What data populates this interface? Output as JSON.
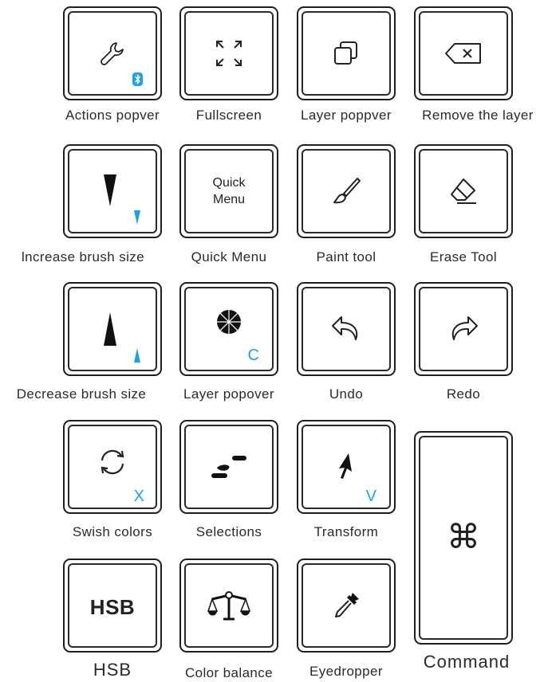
{
  "accent_color": "#1aa3e8",
  "key_border_color": "#1e1e1e",
  "keys": [
    {
      "label": "Actions popver",
      "icon": "wrench-icon",
      "badge": "bluetooth-icon"
    },
    {
      "label": "Fullscreen",
      "icon": "expand-arrows-icon"
    },
    {
      "label": "Layer poppver",
      "icon": "layers-icon"
    },
    {
      "label": "Remove the layer",
      "icon": "backspace-icon"
    },
    {
      "label": "lncrease brush size",
      "icon": "brush-size-increase-icon"
    },
    {
      "label": "Quick Menu",
      "key_text": [
        "Quick",
        "Menu"
      ]
    },
    {
      "label": "Paint tool",
      "icon": "paintbrush-icon"
    },
    {
      "label": "Erase Tool",
      "icon": "eraser-icon"
    },
    {
      "label": "Decrease brush size",
      "icon": "brush-size-decrease-icon"
    },
    {
      "label": "Layer popover",
      "icon": "color-wheel-icon",
      "shortcut": "C"
    },
    {
      "label": "Undo",
      "icon": "undo-arrow-icon"
    },
    {
      "label": "Redo",
      "icon": "redo-arrow-icon"
    },
    {
      "label": "Swish colors",
      "icon": "swap-cycle-icon",
      "shortcut": "X"
    },
    {
      "label": "Selections",
      "icon": "selection-icon"
    },
    {
      "label": "Transform",
      "icon": "cursor-arrow-icon",
      "shortcut": "V"
    },
    {
      "label": "HSB",
      "key_text": "HSB"
    },
    {
      "label": "Color balance",
      "icon": "balance-scale-icon"
    },
    {
      "label": "Eyedropper",
      "icon": "eyedropper-icon"
    },
    {
      "label": "Command",
      "key_text": "⌘",
      "icon": "command-icon"
    }
  ]
}
